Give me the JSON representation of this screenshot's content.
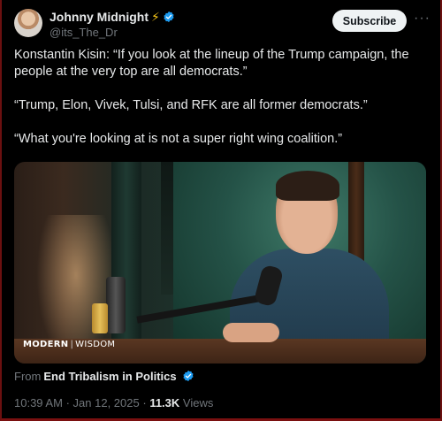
{
  "author": {
    "name": "Johnny Midnight",
    "handle": "@its_The_Dr",
    "badge_icon": "lightning-bolt-icon",
    "verified": true,
    "verified_color": "#1d9bf0"
  },
  "header": {
    "subscribe_label": "Subscribe",
    "more_icon": "more-horizontal-icon"
  },
  "tweet": {
    "paragraphs": [
      "Konstantin Kisin: “If you look at the lineup of the Trump campaign, the people at the very top are all democrats.”",
      "“Trump, Elon, Vivek, Tulsi, and RFK are all former democrats.”",
      "“What you're looking at is not a super right wing coalition.”"
    ]
  },
  "media": {
    "watermark_left": "MODERN",
    "watermark_sep": "|",
    "watermark_right": "WISDOM"
  },
  "community": {
    "prefix": "From",
    "name": "End Tribalism in Politics"
  },
  "meta": {
    "time": "10:39 AM",
    "date": "Jan 12, 2025",
    "dot": "·",
    "views_count": "11.3K",
    "views_label": "Views"
  },
  "colors": {
    "background": "#000000",
    "text_primary": "#e7e9ea",
    "text_secondary": "#71767b",
    "accent": "#1d9bf0",
    "bolt": "#f5c518"
  }
}
